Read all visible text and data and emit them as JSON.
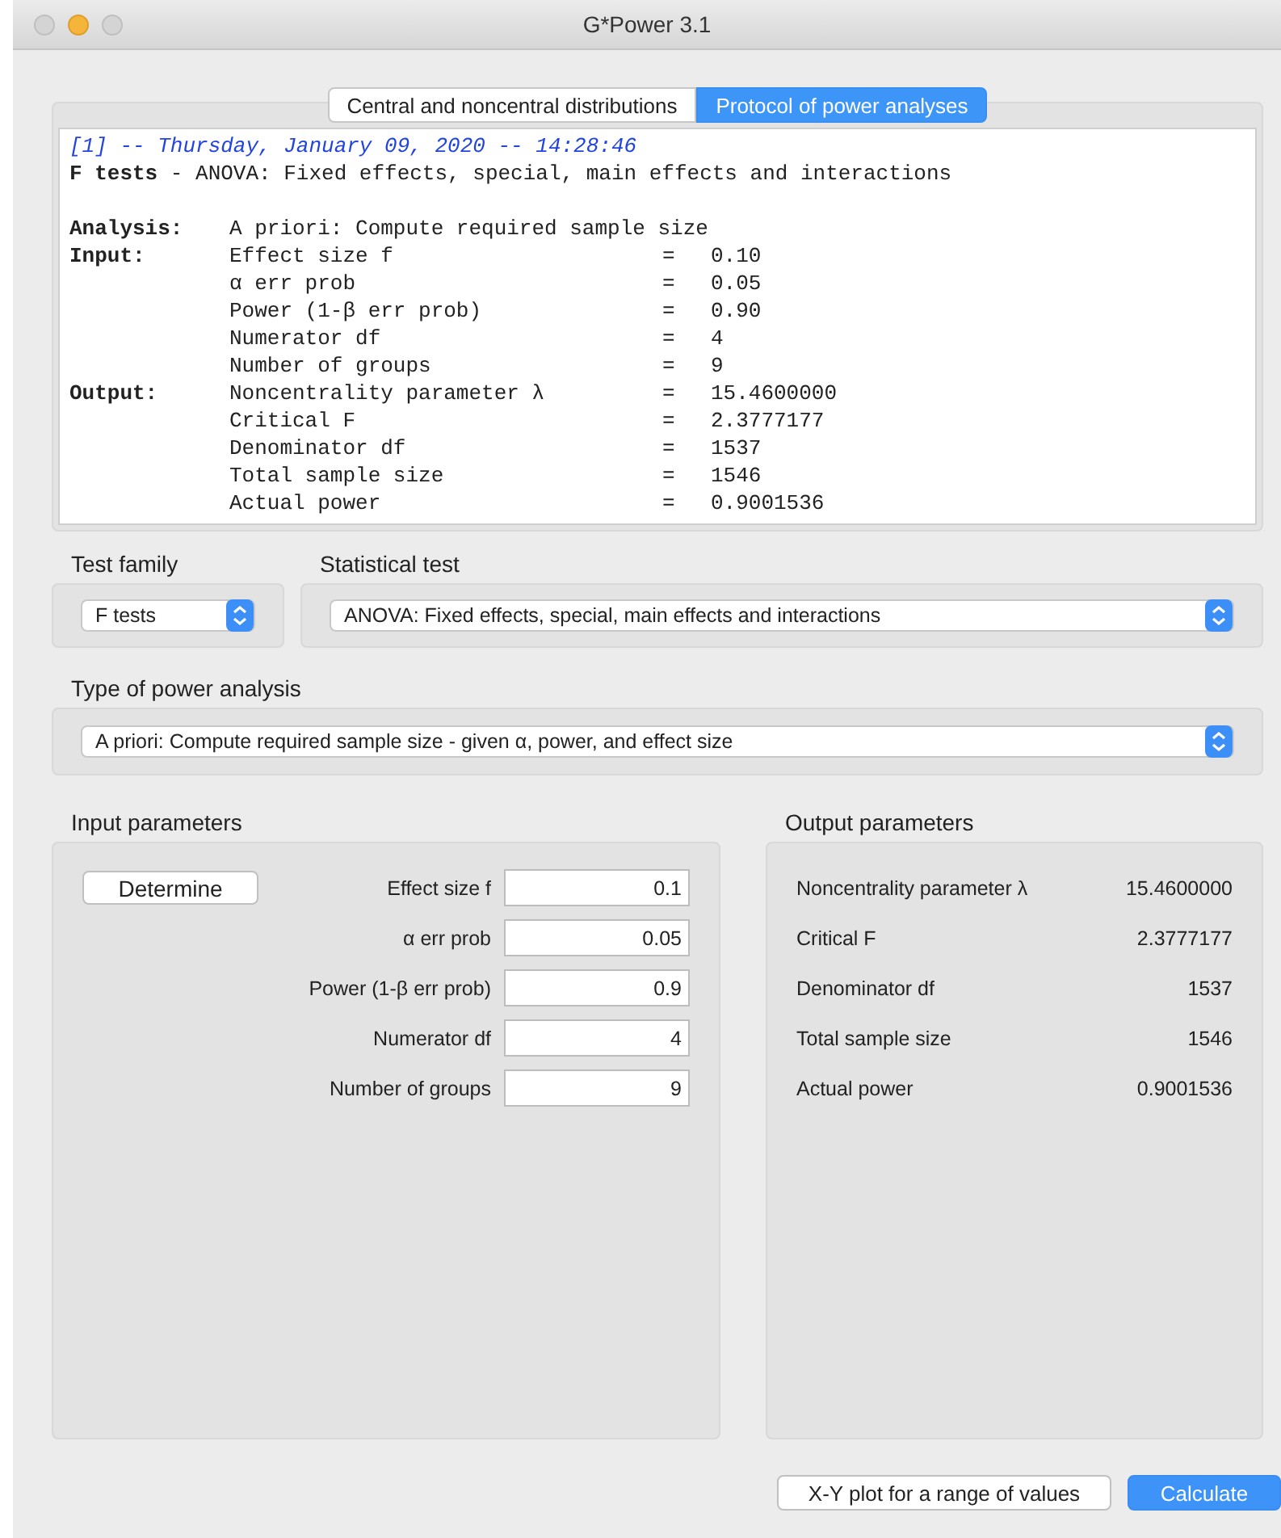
{
  "window": {
    "title": "G*Power 3.1"
  },
  "tabs": [
    {
      "label": "Central and noncentral distributions",
      "selected": false
    },
    {
      "label": "Protocol of power analyses",
      "selected": true
    }
  ],
  "protocol": {
    "header": "[1] -- Thursday, January 09, 2020 -- 14:28:46",
    "test_line": "**F tests** - ANOVA: Fixed effects, special, main effects and interactions",
    "rows": [
      {
        "section": "Analysis:",
        "name": "A priori: Compute required sample size"
      },
      {
        "section": "Input:",
        "name": "Effect size f",
        "equals": "=",
        "value": "0.10"
      },
      {
        "name": "α err prob",
        "equals": "=",
        "value": "0.05"
      },
      {
        "name": "Power (1-β err prob)",
        "equals": "=",
        "value": "0.90"
      },
      {
        "name": "Numerator df",
        "equals": "=",
        "value": "4"
      },
      {
        "name": "Number of groups",
        "equals": "=",
        "value": "9"
      },
      {
        "section": "Output:",
        "name": "Noncentrality parameter λ",
        "equals": "=",
        "value": "15.4600000"
      },
      {
        "name": "Critical F",
        "equals": "=",
        "value": "2.3777177"
      },
      {
        "name": "Denominator df",
        "equals": "=",
        "value": "1537"
      },
      {
        "name": "Total sample size",
        "equals": "=",
        "value": "1546"
      },
      {
        "name": "Actual power",
        "equals": "=",
        "value": "0.9001536"
      }
    ]
  },
  "test_family": {
    "label": "Test family",
    "value": "F tests"
  },
  "statistical_test": {
    "label": "Statistical test",
    "value": "ANOVA: Fixed effects, special, main effects and interactions"
  },
  "power_analysis_type": {
    "label": "Type of power analysis",
    "value": "A priori: Compute required sample size - given α, power, and effect size"
  },
  "input_parameters": {
    "title": "Input parameters",
    "determine_button": "Determine",
    "fields": [
      {
        "label": "Effect size f",
        "value": "0.1"
      },
      {
        "label": "α err prob",
        "value": "0.05"
      },
      {
        "label": "Power (1-β err prob)",
        "value": "0.9"
      },
      {
        "label": "Numerator df",
        "value": "4"
      },
      {
        "label": "Number of groups",
        "value": "9"
      }
    ]
  },
  "output_parameters": {
    "title": "Output parameters",
    "rows": [
      {
        "label": "Noncentrality parameter λ",
        "value": "15.4600000"
      },
      {
        "label": "Critical F",
        "value": "2.3777177"
      },
      {
        "label": "Denominator df",
        "value": "1537"
      },
      {
        "label": "Total sample size",
        "value": "1546"
      },
      {
        "label": "Actual power",
        "value": "0.9001536"
      }
    ]
  },
  "buttons": [
    {
      "label": "X-Y plot for a range of values",
      "kind": "default"
    },
    {
      "label": "Calculate",
      "kind": "primary"
    }
  ]
}
